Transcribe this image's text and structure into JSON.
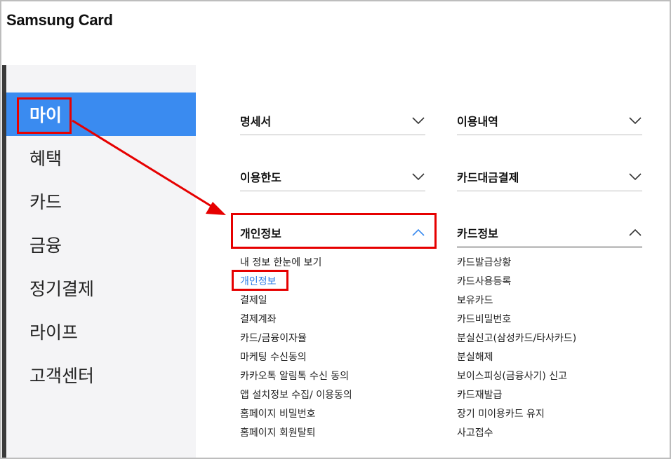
{
  "brand": {
    "name": "Samsung Card"
  },
  "sidebar": {
    "items": [
      {
        "label": "마이",
        "active": true
      },
      {
        "label": "혜택",
        "active": false
      },
      {
        "label": "카드",
        "active": false
      },
      {
        "label": "금융",
        "active": false
      },
      {
        "label": "정기결제",
        "active": false
      },
      {
        "label": "라이프",
        "active": false
      },
      {
        "label": "고객센터",
        "active": false
      }
    ]
  },
  "menu": {
    "left_column": [
      {
        "label": "명세서",
        "expanded": false
      },
      {
        "label": "이용한도",
        "expanded": false
      },
      {
        "label": "개인정보",
        "expanded": true,
        "items": [
          "내 정보 한눈에 보기",
          "개인정보",
          "결제일",
          "결제계좌",
          "카드/금융이자율",
          "마케팅 수신동의",
          "카카오톡 알림톡 수신 동의",
          "앱 설치정보 수집/ 이용동의",
          "홈페이지 비밀번호",
          "홈페이지 회원탈퇴"
        ],
        "active_item": "개인정보"
      }
    ],
    "right_column": [
      {
        "label": "이용내역",
        "expanded": false
      },
      {
        "label": "카드대금결제",
        "expanded": false
      },
      {
        "label": "카드정보",
        "expanded": true,
        "items": [
          "카드발급상황",
          "카드사용등록",
          "보유카드",
          "카드비밀번호",
          "분실신고(삼성카드/타사카드)",
          "분실해제",
          "보이스피싱(금융사기) 신고",
          "카드재발급",
          "장기 미이용카드 유지",
          "사고접수"
        ]
      }
    ]
  },
  "icons": {
    "collapsed": "chevron-down-icon",
    "expanded": "chevron-up-icon"
  },
  "colors": {
    "accent": "#3a8bf0",
    "active_link": "#2f7ee6",
    "highlight": "#e60000",
    "sidebar_bg": "#f4f4f6"
  }
}
